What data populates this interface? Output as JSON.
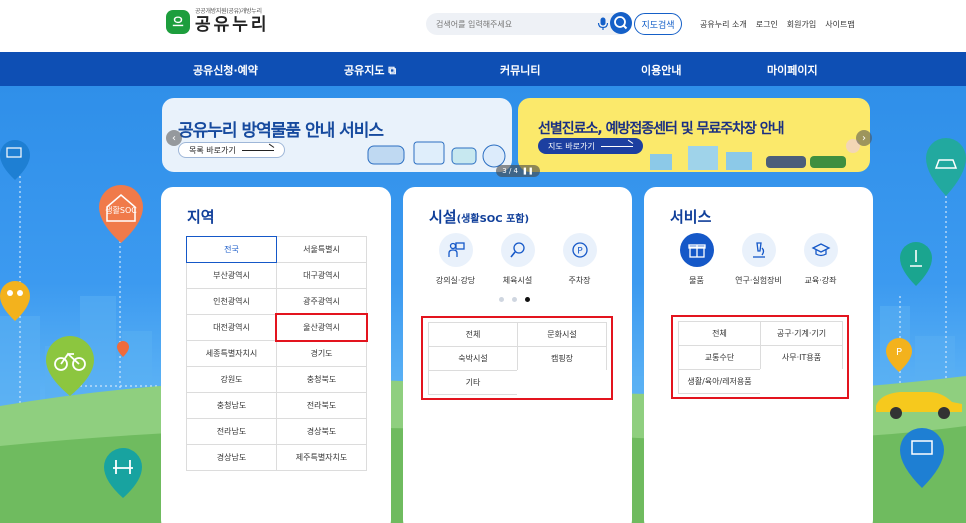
{
  "header": {
    "logo_mark": "으",
    "logo_sub": "공공개방지원(공유)개방누리",
    "logo_main": "공유누리",
    "search_placeholder": "검색어를 입력해주세요",
    "map_search_label": "지도검색",
    "links": [
      "공유누리 소개",
      "로그인",
      "회원가입",
      "사이트맵"
    ]
  },
  "nav": {
    "items": [
      "공유신청·예약",
      "공유지도 ⧉",
      "커뮤니티",
      "이용안내",
      "마이페이지"
    ]
  },
  "banners": {
    "b1": {
      "title": "공유누리 방역물품 안내 서비스",
      "button": "목록 바로가기"
    },
    "b2": {
      "title": "선별진료소, 예방접종센터 및 무료주차장 안내",
      "button": "지도 바로가기"
    },
    "pager": "3 / 4",
    "pause": "❚❚"
  },
  "region_card": {
    "title": "지역",
    "regions": [
      "전국",
      "서울특별시",
      "부산광역시",
      "대구광역시",
      "인천광역시",
      "광주광역시",
      "대전광역시",
      "울산광역시",
      "세종특별자치시",
      "경기도",
      "강원도",
      "충청북도",
      "충청남도",
      "전라북도",
      "전라남도",
      "경상북도",
      "경상남도",
      "제주특별자치도"
    ]
  },
  "facility_card": {
    "title": "시설",
    "title_small": "(생활SOC 포함)",
    "icons": [
      "강의실·강당",
      "체육시설",
      "주차장"
    ],
    "categories": [
      "전체",
      "문화시설",
      "숙박시설",
      "캠핑장",
      "기타"
    ]
  },
  "service_card": {
    "title": "서비스",
    "icons": [
      "물품",
      "연구·실험장비",
      "교육·강좌"
    ],
    "categories": [
      "전체",
      "공구·기계·기기",
      "교통수단",
      "사무·IT용품",
      "생활/육아/레저용품"
    ]
  },
  "side_badge": "생활SOC",
  "colors": {
    "primary": "#0e4fb4",
    "accent": "#1558c8",
    "highlight": "#e3141e"
  }
}
